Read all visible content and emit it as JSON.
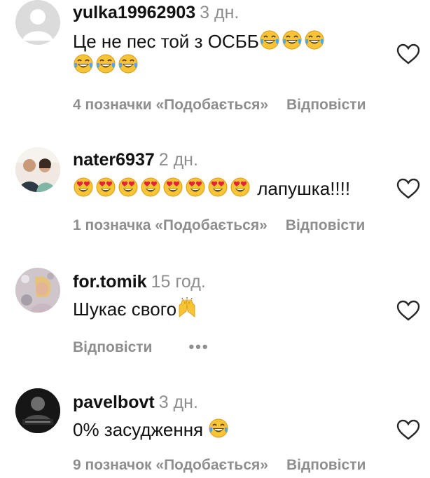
{
  "comments": [
    {
      "username": "yulka19962903",
      "time": "3 дн.",
      "text": "Це не пес той з ОСББ",
      "emoji_line1": [
        "laughing-crying",
        "laughing-crying",
        "laughing-crying"
      ],
      "emoji_line2": [
        "laughing-crying",
        "laughing-crying",
        "laughing-crying"
      ],
      "likes": "4 позначки «Подобається»",
      "reply": "Відповісти"
    },
    {
      "username": "nater6937",
      "time": "2 дн.",
      "text": "лапушка!!!!",
      "emoji_prefix": [
        "heart-eyes",
        "heart-eyes",
        "heart-eyes",
        "heart-eyes",
        "heart-eyes",
        "heart-eyes",
        "heart-eyes",
        "heart-eyes"
      ],
      "likes": "1 позначка «Подобається»",
      "reply": "Відповісти"
    },
    {
      "username": "for.tomik",
      "time": "15 год.",
      "text": "Шукає свого",
      "emoji_suffix": [
        "raising-hands"
      ],
      "reply": "Відповісти",
      "more": "•••"
    },
    {
      "username": "pavelbovt",
      "time": "3 дн.",
      "text": "0% засудження",
      "emoji_suffix": [
        "laughing-crying"
      ],
      "likes": "9 позначок «Подобається»",
      "reply": "Відповісти"
    }
  ],
  "colors": {
    "text": "#111111",
    "secondary": "#8e8e8e",
    "emoji_yellow": "#f7c436",
    "heart_red": "#e8213b",
    "tear_blue": "#4ea8e8"
  }
}
